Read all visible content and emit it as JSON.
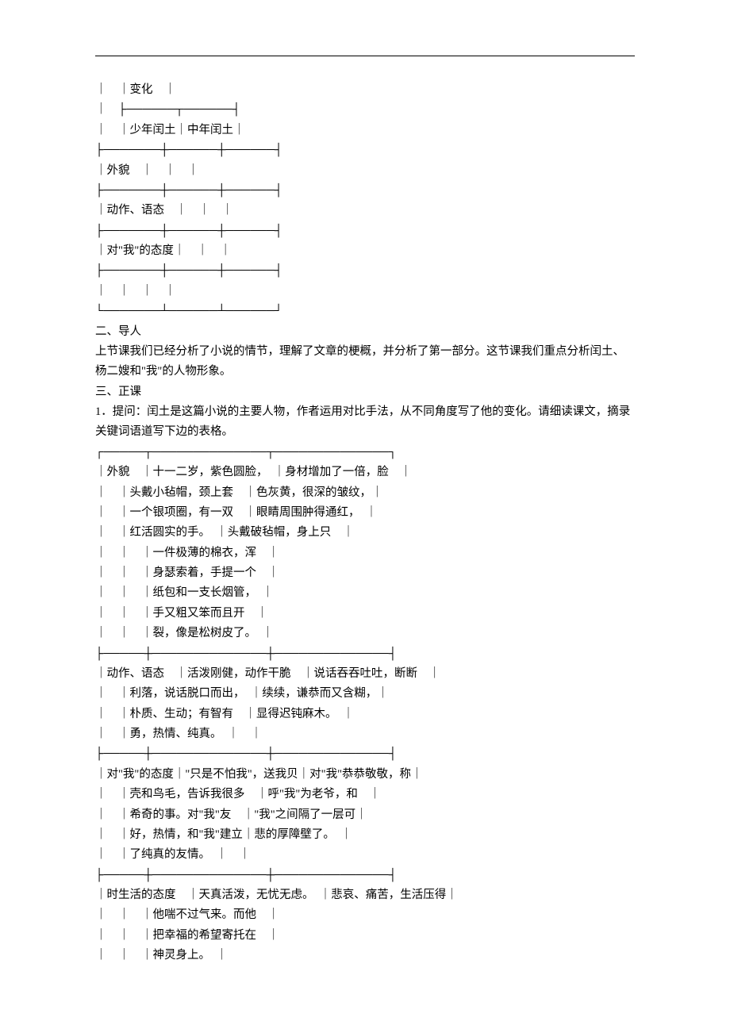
{
  "table1": {
    "r1": "｜　｜变化　｜",
    "r2": "｜　├──────┬──────┤",
    "r3": "｜　｜少年闰土｜中年闰土｜",
    "r4": "├───────┼──────┼──────┤",
    "r5": "｜外貌　｜　｜　｜",
    "r6": "├───────┼──────┼──────┤",
    "r7": "｜动作、语态　｜　｜　｜",
    "r8": "├───────┼──────┼──────┤",
    "r9": "｜对\"我\"的态度｜　｜　｜",
    "r10": "├───────┼──────┼──────┤",
    "r11": "｜　｜　｜　｜",
    "r12": "└───────┴──────┴──────┘"
  },
  "h2": "二、导人",
  "p1": "上节课我们已经分析了小说的情节，理解了文章的梗概，并分析了第一部分。这节课我们重点分析闰土、杨二嫂和\"我\"的人物形象。",
  "h3": "三、正课",
  "p2": "1．提问：闰土是这篇小说的主要人物，作者运用对比手法，从不同角度写了他的变化。请细读课文，摘录关键词语道写下边的表格。",
  "table2": {
    "r0": "┌─────┬──────────────┬──────────────┐",
    "r1": "｜外貌　｜十一二岁，紫色圆脸，　｜身材增加了一倍，脸　｜",
    "r2": "｜　｜头戴小毡帽，颈上套　｜色灰黄，很深的皱纹，｜",
    "r3": "｜　｜一个银项圈，有一双　｜眼睛周围肿得通红，　｜",
    "r4": "｜　｜红活圆实的手。　｜头戴破毡帽，身上只　｜",
    "r5": "｜　｜　｜一件极薄的棉衣，浑　｜",
    "r6": "｜　｜　｜身瑟索着，手提一个　｜",
    "r7": "｜　｜　｜纸包和一支长烟管，　｜",
    "r8": "｜　｜　｜手又粗又笨而且开　｜",
    "r9": "｜　｜　｜裂，像是松树皮了。　｜",
    "r10": "├─────┼──────────────┼──────────────┤",
    "r11": "｜动作、语态　｜活泼刚健，动作干脆　｜说话吞吞吐吐，断断　｜",
    "r12": "｜　｜利落，说话脱口而出，　｜续续，谦恭而又含糊，｜",
    "r13": "｜　｜朴质、生动；有智有　｜显得迟钝麻木。　｜",
    "r14": "｜　｜勇，热情、纯真。　｜　｜",
    "r15": "├─────┼──────────────┼──────────────┤",
    "r16": "｜对\"我\"的态度｜\"只是不怕我\"，送我贝｜对\"我\"恭恭敬敬，称｜",
    "r17": "｜　｜壳和鸟毛，告诉我很多　｜呼\"我\"为老爷，和　｜",
    "r18": "｜　｜希奇的事。对\"我\"友　｜\"我\"之间隔了一层可｜",
    "r19": "｜　｜好，热情，和\"我\"建立｜悲的厚障壁了。　｜",
    "r20": "｜　｜了纯真的友情。　｜　｜",
    "r21": "├─────┼──────────────┼──────────────┤",
    "r22": "｜时生活的态度　｜天真活泼，无忧无虑。　｜悲哀、痛苦，生活压得｜",
    "r23": "｜　｜　｜他喘不过气来。而他　｜",
    "r24": "｜　｜　｜把幸福的希望寄托在　｜",
    "r25": "｜　｜　｜神灵身上。　｜"
  }
}
